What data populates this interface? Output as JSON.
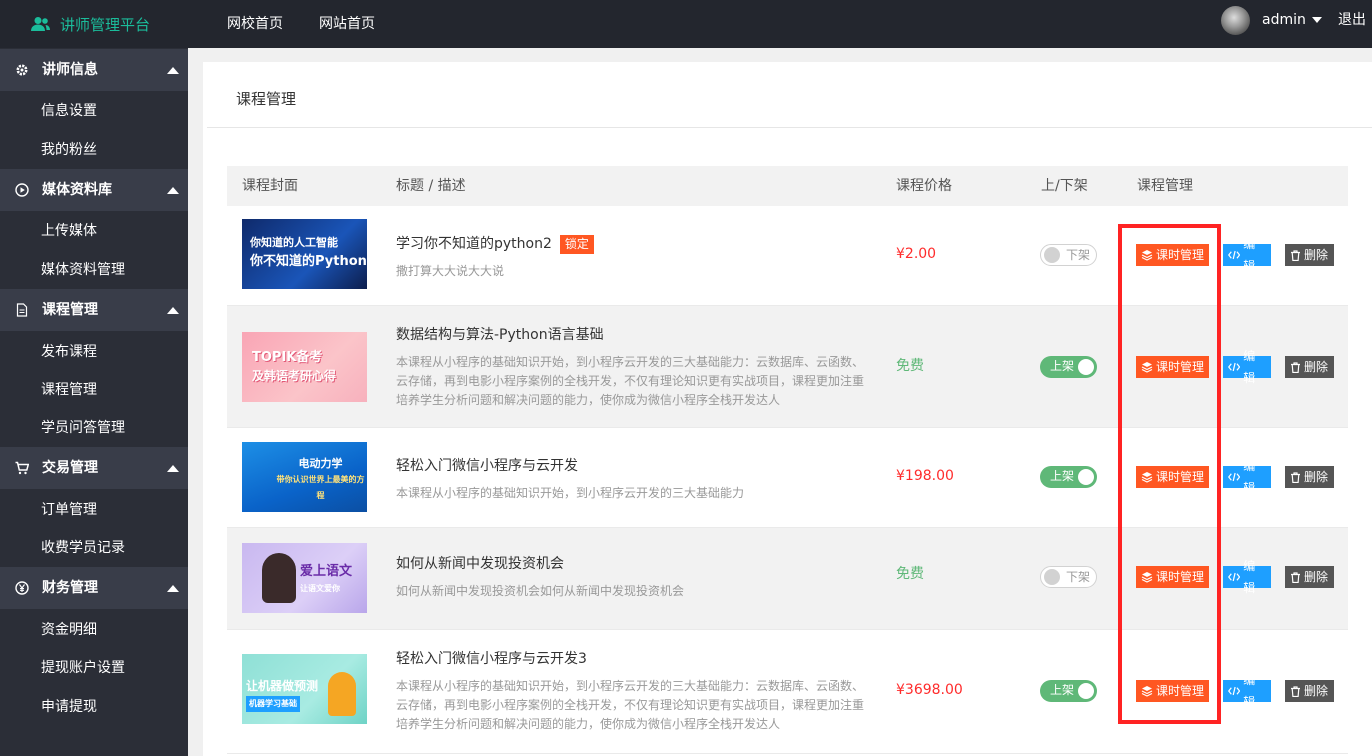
{
  "topbar": {
    "brand": "讲师管理平台",
    "nav": [
      "网校首页",
      "网站首页"
    ],
    "user": "admin",
    "logout": "退出"
  },
  "sidebar": [
    {
      "label": "讲师信息",
      "icon": "gear-icon",
      "items": [
        "信息设置",
        "我的粉丝"
      ]
    },
    {
      "label": "媒体资料库",
      "icon": "play-circle-icon",
      "items": [
        "上传媒体",
        "媒体资料管理"
      ]
    },
    {
      "label": "课程管理",
      "icon": "document-icon",
      "items": [
        "发布课程",
        "课程管理",
        "学员问答管理"
      ]
    },
    {
      "label": "交易管理",
      "icon": "cart-icon",
      "items": [
        "订单管理",
        "收费学员记录"
      ]
    },
    {
      "label": "财务管理",
      "icon": "yen-circle-icon",
      "items": [
        "资金明细",
        "提现账户设置",
        "申请提现"
      ]
    }
  ],
  "main": {
    "title": "课程管理",
    "columns": [
      "课程封面",
      "标题 / 描述",
      "课程价格",
      "上/下架",
      "课程管理"
    ],
    "buttons": {
      "lessons": "课时管理",
      "edit": "编辑",
      "delete": "删除"
    },
    "rows": [
      {
        "cover_lines": [
          "你知道的人工智能",
          "你不知道的Python"
        ],
        "title": "学习你不知道的python2",
        "badge": "锁定",
        "desc": "撒打算大大说大大说",
        "price": "¥2.00",
        "free": false,
        "status": "下架",
        "on": false
      },
      {
        "cover_lines": [
          "TOPIK备考",
          "及韩语考研心得"
        ],
        "title": "数据结构与算法-Python语言基础",
        "badge": "",
        "desc": "本课程从小程序的基础知识开始，到小程序云开发的三大基础能力：云数据库、云函数、云存储，再到电影小程序案例的全栈开发，不仅有理论知识更有实战项目，课程更加注重培养学生分析问题和解决问题的能力，使你成为微信小程序全栈开发达人",
        "price": "免费",
        "free": true,
        "status": "上架",
        "on": true
      },
      {
        "cover_lines": [
          "电动力学",
          "带你认识世界上最美的方程"
        ],
        "title": "轻松入门微信小程序与云开发",
        "badge": "",
        "desc": "本课程从小程序的基础知识开始，到小程序云开发的三大基础能力",
        "price": "¥198.00",
        "free": false,
        "status": "上架",
        "on": true
      },
      {
        "cover_lines": [
          "爱上语文",
          "让语文爱你"
        ],
        "title": "如何从新闻中发现投资机会",
        "badge": "",
        "desc": "如何从新闻中发现投资机会如何从新闻中发现投资机会",
        "price": "免费",
        "free": true,
        "status": "下架",
        "on": false
      },
      {
        "cover_lines": [
          "让机器做预测",
          "机器学习基础"
        ],
        "title": "轻松入门微信小程序与云开发3",
        "badge": "",
        "desc": "本课程从小程序的基础知识开始，到小程序云开发的三大基础能力：云数据库、云函数、云存储，再到电影小程序案例的全栈开发，不仅有理论知识更有实战项目，课程更加注重培养学生分析问题和解决问题的能力，使你成为微信小程序全栈开发达人",
        "price": "¥3698.00",
        "free": false,
        "status": "上架",
        "on": true
      }
    ]
  },
  "colors": {
    "accent": "#1bbc9b",
    "orange": "#ff5722",
    "blue": "#1e9fff",
    "green": "#5fb878",
    "price_red": "#ff2c2c",
    "highlight": "#ff2323"
  }
}
